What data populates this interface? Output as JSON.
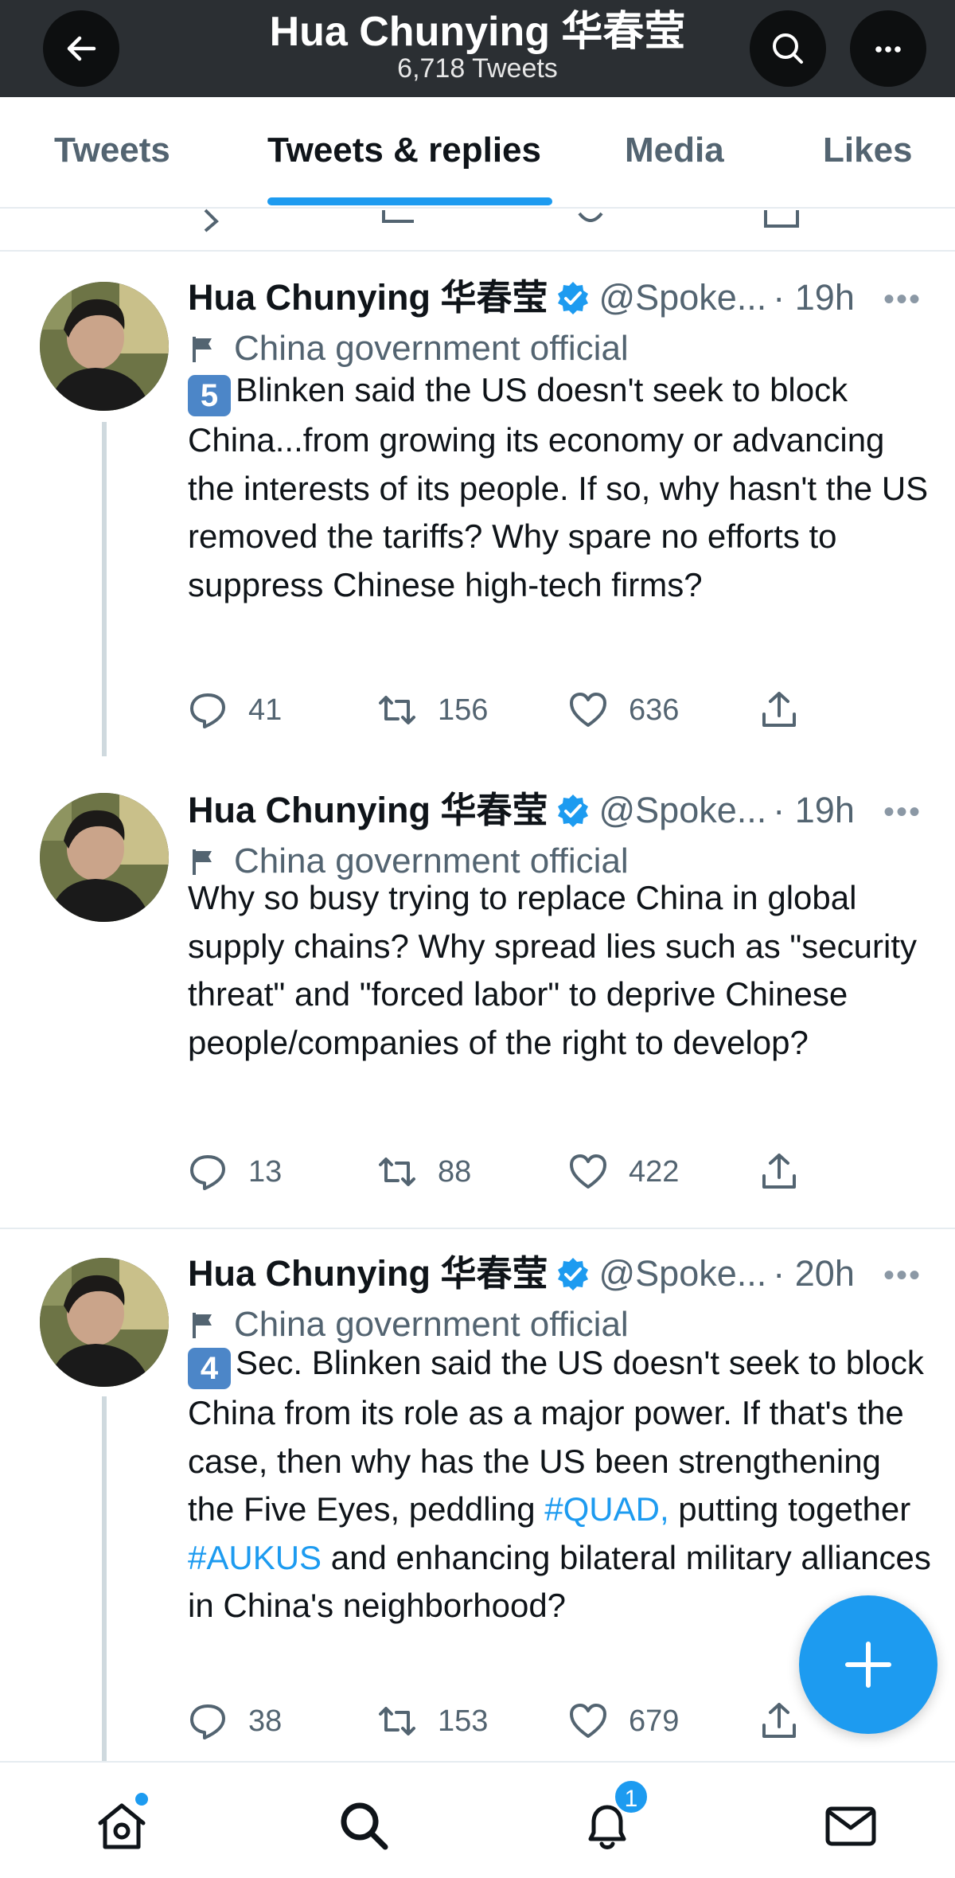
{
  "header": {
    "title": "Hua Chunying 华春莹",
    "subtitle": "6,718 Tweets"
  },
  "tabs": [
    {
      "label": "Tweets",
      "active": false
    },
    {
      "label": "Tweets & replies",
      "active": true
    },
    {
      "label": "Media",
      "active": false
    },
    {
      "label": "Likes",
      "active": false
    }
  ],
  "tweets": [
    {
      "name": "Hua Chunying 华春莹",
      "handle": "@Spoke...",
      "time": "· 19h",
      "label": "China government official",
      "keycap": "5",
      "text_parts": [
        "Blinken said the US doesn't seek to block China...from growing its economy or advancing the interests of its people. If so, why hasn't the US removed the tariffs? Why spare no efforts to suppress Chinese high-tech firms?"
      ],
      "replies": "41",
      "retweets": "156",
      "likes": "636"
    },
    {
      "name": "Hua Chunying 华春莹",
      "handle": "@Spoke...",
      "time": "· 19h",
      "label": "China government official",
      "text_parts": [
        "Why so busy trying to replace China in global supply chains? Why spread lies such as \"security threat\" and \"forced labor\" to deprive Chinese people/companies of the right to develop?"
      ],
      "replies": "13",
      "retweets": "88",
      "likes": "422"
    },
    {
      "name": "Hua Chunying 华春莹",
      "handle": "@Spoke...",
      "time": "· 20h",
      "label": "China government official",
      "keycap": "4",
      "text_parts": [
        "Sec. Blinken said the US doesn't seek to block China from its role as a major power. If that's the case, then why has the US been strengthening the Five Eyes, peddling ",
        " putting together ",
        " and enhancing bilateral military alliances in China's neighborhood?"
      ],
      "hashtags": [
        "#QUAD,",
        "#AUKUS"
      ],
      "replies": "38",
      "retweets": "153",
      "likes": "679"
    }
  ],
  "bottom_nav": {
    "notifications_badge": "1"
  },
  "colors": {
    "accent": "#1d9bf0",
    "header_bg": "#2b2f33",
    "muted": "#536471"
  },
  "icons": [
    "back-arrow-icon",
    "search-icon",
    "more-icon",
    "verified-icon",
    "flag-icon",
    "reply-icon",
    "retweet-icon",
    "like-icon",
    "share-icon",
    "compose-icon",
    "home-icon",
    "notifications-icon",
    "messages-icon"
  ]
}
